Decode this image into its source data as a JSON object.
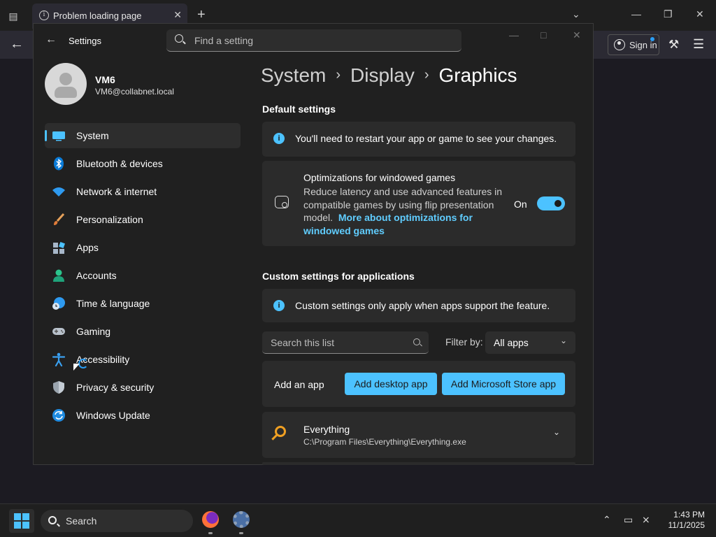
{
  "browser": {
    "tab_title": "Problem loading page",
    "sign_in_label": "Sign in"
  },
  "settings": {
    "app_title": "Settings",
    "search_placeholder": "Find a setting",
    "user": {
      "name": "VM6",
      "email": "VM6@collabnet.local"
    },
    "nav": [
      {
        "label": "System",
        "icon": "monitor-icon",
        "active": true
      },
      {
        "label": "Bluetooth & devices",
        "icon": "bluetooth-icon"
      },
      {
        "label": "Network & internet",
        "icon": "wifi-icon"
      },
      {
        "label": "Personalization",
        "icon": "brush-icon"
      },
      {
        "label": "Apps",
        "icon": "apps-icon"
      },
      {
        "label": "Accounts",
        "icon": "person-icon"
      },
      {
        "label": "Time & language",
        "icon": "globe-clock-icon"
      },
      {
        "label": "Gaming",
        "icon": "controller-icon"
      },
      {
        "label": "Accessibility",
        "icon": "accessibility-icon"
      },
      {
        "label": "Privacy & security",
        "icon": "shield-icon"
      },
      {
        "label": "Windows Update",
        "icon": "update-icon"
      }
    ],
    "breadcrumb": [
      "System",
      "Display",
      "Graphics"
    ],
    "default_section": "Default settings",
    "restart_notice": "You'll need to restart your app or game to see your changes.",
    "windowed_opt": {
      "title": "Optimizations for windowed games",
      "desc": "Reduce latency and use advanced features in compatible games by using flip presentation model.",
      "link": "More about optimizations for windowed games",
      "state_label": "On",
      "enabled": true
    },
    "custom_section": "Custom settings for applications",
    "custom_notice": "Custom settings only apply when apps support the feature.",
    "list_search_placeholder": "Search this list",
    "filter_label": "Filter by:",
    "filter_value": "All apps",
    "add_app_label": "Add an app",
    "add_desktop_btn": "Add desktop app",
    "add_store_btn": "Add Microsoft Store app",
    "apps": [
      {
        "name": "Everything",
        "path": "C:\\Program Files\\Everything\\Everything.exe"
      }
    ]
  },
  "taskbar": {
    "search_label": "Search",
    "time": "1:43 PM",
    "date": "11/1/2025"
  },
  "colors": {
    "accent": "#4cc2ff",
    "link": "#60cdff"
  }
}
